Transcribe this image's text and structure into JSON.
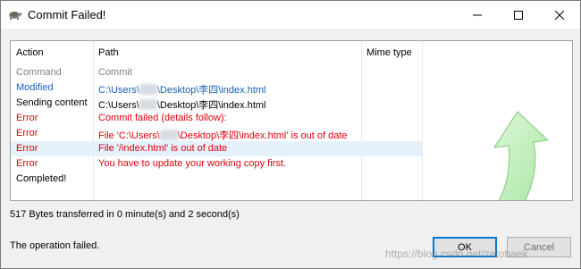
{
  "window": {
    "title": "Commit Failed!",
    "icon": "tortoise-svn-icon",
    "controls": [
      "minimize-icon",
      "maximize-icon",
      "close-icon"
    ]
  },
  "table": {
    "columns": [
      "Action",
      "Path",
      "Mime type"
    ],
    "rows": [
      {
        "action": "Command",
        "path": "Commit",
        "color": "#808080",
        "selected": false
      },
      {
        "action": "Modified",
        "path": [
          "C:\\Users\\",
          "\\Desktop\\李四\\index.html"
        ],
        "color": "#1a5fb4",
        "selected": false
      },
      {
        "action": "Sending content",
        "path": [
          "C:\\Users\\",
          "\\Desktop\\李四\\index.html"
        ],
        "color": "#000000",
        "selected": false
      },
      {
        "action": "Error",
        "path": "Commit failed (details follow):",
        "color": "#e0000c",
        "selected": false
      },
      {
        "action": "Error",
        "path": [
          "File 'C:\\Users\\",
          "\\Desktop\\李四\\index.html' is out of date"
        ],
        "color": "#e0000c",
        "selected": false
      },
      {
        "action": "Error",
        "path": "File '/index.html' is out of date",
        "color": "#e0000c",
        "selected": true
      },
      {
        "action": "Error",
        "path": "You have to update your working copy first.",
        "color": "#e0000c",
        "selected": false
      },
      {
        "action": "Completed!",
        "path": "",
        "color": "#000000",
        "selected": false
      }
    ]
  },
  "status": {
    "transfer": "517 Bytes transferred in 0 minute(s) and 2 second(s)",
    "result": "The operation failed."
  },
  "buttons": {
    "ok": "OK",
    "cancel": "Cancel"
  },
  "watermark": "https://blog.csdn.net/zetobaek",
  "colors": {
    "selection": "#e5f1fb",
    "error": "#e0000c",
    "modified": "#1a5fb4",
    "arrow": "#b8f0b0"
  }
}
